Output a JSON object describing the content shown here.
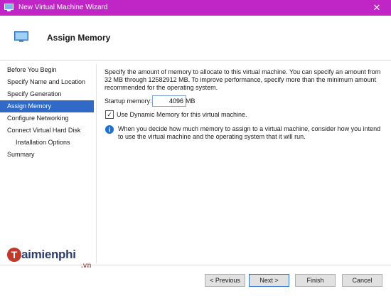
{
  "window": {
    "title": "New Virtual Machine Wizard",
    "close_glyph": "✕",
    "accent_color": "#c026c6"
  },
  "header": {
    "title": "Assign Memory",
    "icon": "monitor-icon"
  },
  "sidebar": {
    "items": [
      {
        "label": "Before You Begin",
        "active": false
      },
      {
        "label": "Specify Name and Location",
        "active": false
      },
      {
        "label": "Specify Generation",
        "active": false
      },
      {
        "label": "Assign Memory",
        "active": true
      },
      {
        "label": "Configure Networking",
        "active": false
      },
      {
        "label": "Connect Virtual Hard Disk",
        "active": false
      },
      {
        "label": "Installation Options",
        "active": false
      },
      {
        "label": "Summary",
        "active": false
      }
    ]
  },
  "main": {
    "description": "Specify the amount of memory to allocate to this virtual machine. You can specify an amount from 32 MB through 12582912 MB. To improve performance, specify more than the minimum amount recommended for the operating system.",
    "startup_memory_label": "Startup memory:",
    "startup_memory_value": "4096",
    "startup_memory_unit": "MB",
    "dynamic_memory_label": "Use Dynamic Memory for this virtual machine.",
    "dynamic_memory_checked": true,
    "info_text": "When you decide how much memory to assign to a virtual machine, consider how you intend to use the virtual machine and the operating system that it will run."
  },
  "buttons": {
    "previous": "< Previous",
    "next": "Next >",
    "finish": "Finish",
    "cancel": "Cancel"
  },
  "watermark": {
    "logo_letter": "T",
    "brand": "aimienphi",
    "suffix": ".vn"
  }
}
